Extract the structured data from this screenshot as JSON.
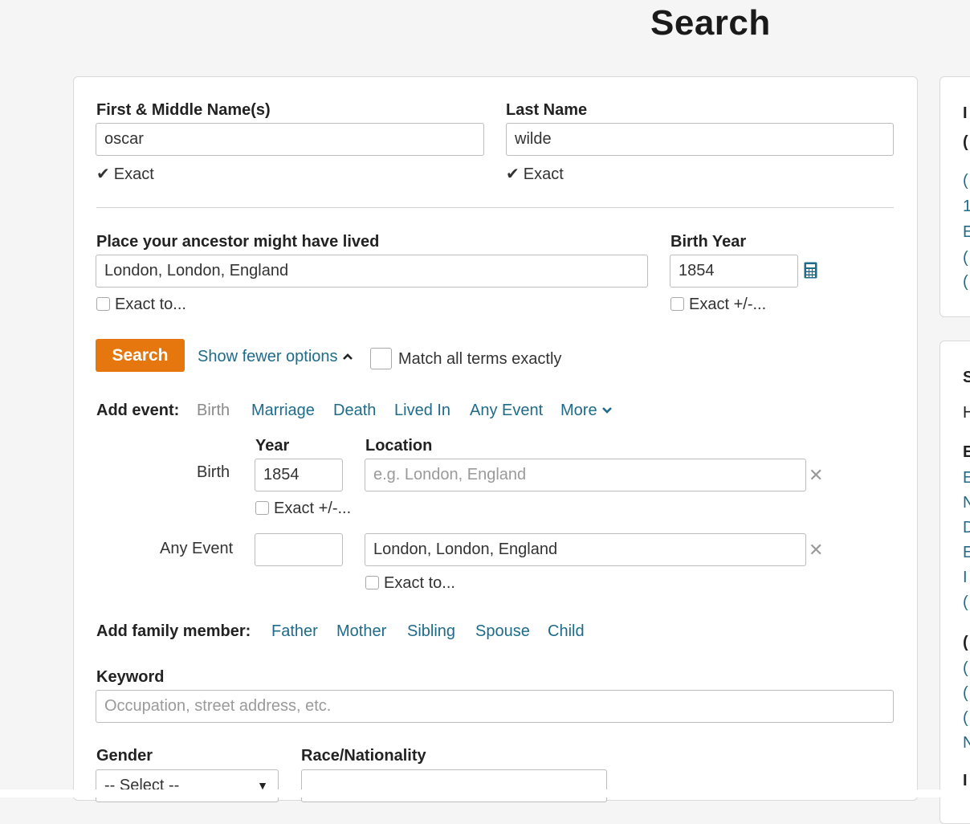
{
  "page": {
    "title": "Search"
  },
  "name_section": {
    "first_label": "First & Middle Name(s)",
    "first_value": "oscar",
    "first_exact": "Exact",
    "last_label": "Last Name",
    "last_value": "wilde",
    "last_exact": "Exact"
  },
  "place_section": {
    "place_label": "Place your ancestor might have lived",
    "place_value": "London, London, England",
    "place_exact": "Exact to...",
    "birth_label": "Birth Year",
    "birth_value": "1854",
    "birth_exact": "Exact +/-..."
  },
  "actions": {
    "search_label": "Search",
    "show_fewer": "Show fewer options",
    "match_all": "Match all terms exactly"
  },
  "add_event": {
    "label": "Add event:",
    "options": [
      "Birth",
      "Marriage",
      "Death",
      "Lived In",
      "Any Event",
      "More"
    ]
  },
  "events": {
    "year_header": "Year",
    "location_header": "Location",
    "birth": {
      "label": "Birth",
      "year": "1854",
      "location_placeholder": "e.g. London, England",
      "exact": "Exact +/-..."
    },
    "any_event": {
      "label": "Any Event",
      "year": "",
      "location": "London, London, England",
      "exact": "Exact to..."
    }
  },
  "family": {
    "label": "Add family member:",
    "options": [
      "Father",
      "Mother",
      "Sibling",
      "Spouse",
      "Child"
    ]
  },
  "keyword": {
    "label": "Keyword",
    "placeholder": "Occupation, street address, etc."
  },
  "demographics": {
    "gender_label": "Gender",
    "gender_value": "-- Select --",
    "race_label": "Race/Nationality"
  },
  "icons": {
    "check": "check-icon",
    "chevron_up": "chevron-up-icon",
    "chevron_down": "chevron-down-icon",
    "close": "close-icon",
    "calendar": "calendar-icon"
  },
  "colors": {
    "accent": "#e5770e",
    "link": "#1e6b8a",
    "border": "#bcbcbc"
  }
}
